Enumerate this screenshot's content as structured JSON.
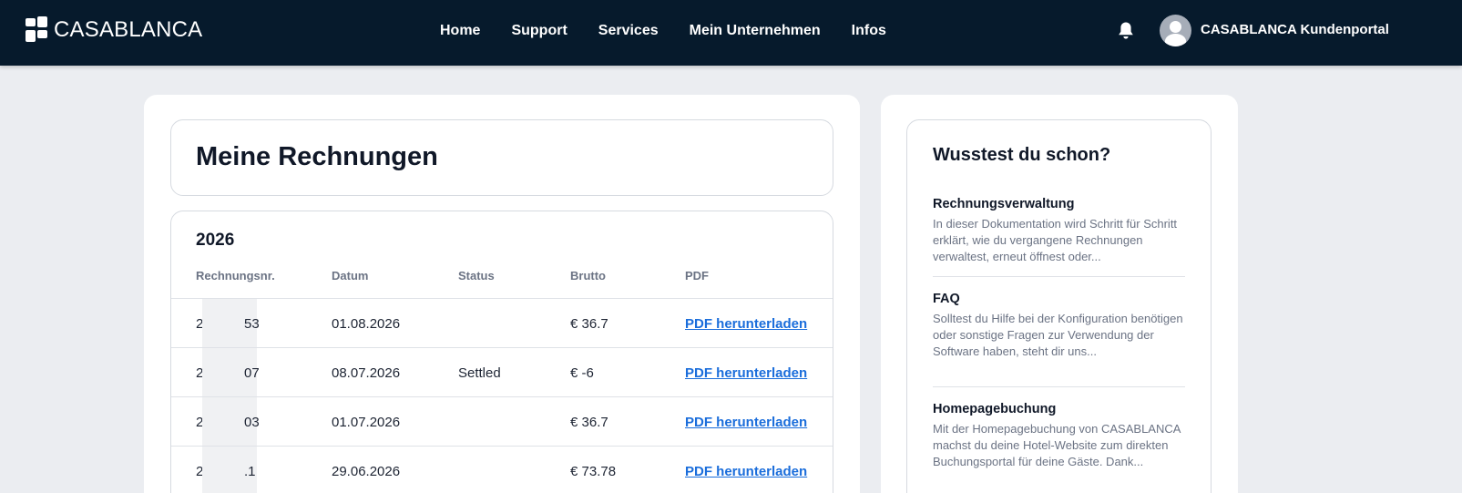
{
  "header": {
    "logo_text": "CASABLANCA",
    "nav": [
      "Home",
      "Support",
      "Services",
      "Mein Unternehmen",
      "Infos"
    ],
    "notification_icon": "bell-icon",
    "user_name": "CASABLANCA Kundenportal",
    "background_color": "#061a2c"
  },
  "main": {
    "title": "Meine Rechnungen",
    "year": "2026",
    "columns": [
      "Rechnungsnr.",
      "Datum",
      "Status",
      "Brutto",
      "PDF"
    ],
    "rows": [
      {
        "nr_start": "2",
        "nr_end": "53",
        "datum": "01.08.2026",
        "status": "",
        "brutto": "€ 36.7",
        "pdf": "PDF herunterladen"
      },
      {
        "nr_start": "2",
        "nr_end": "07",
        "datum": "08.07.2026",
        "status": "Settled",
        "brutto": "€ -6",
        "pdf": "PDF herunterladen"
      },
      {
        "nr_start": "2",
        "nr_end": "03",
        "datum": "01.07.2026",
        "status": "",
        "brutto": "€ 36.7",
        "pdf": "PDF herunterladen"
      },
      {
        "nr_start": "2",
        "nr_end": ".1",
        "datum": "29.06.2026",
        "status": "",
        "brutto": "€ 73.78",
        "pdf": "PDF herunterladen"
      }
    ],
    "link_color": "#1a6ddb"
  },
  "sidebar": {
    "title": "Wusstest du schon?",
    "tips": [
      {
        "title": "Rechnungsverwaltung",
        "text": "In dieser Dokumentation wird Schritt für Schritt erklärt, wie du vergangene Rechnungen verwaltest, erneut öffnest oder..."
      },
      {
        "title": "FAQ",
        "text": "Solltest du Hilfe bei der Konfiguration benötigen oder sonstige Fragen zur Verwendung der Software haben, steht dir uns..."
      },
      {
        "title": "Homepagebuchung",
        "text": "Mit der Homepagebuchung von CASABLANCA machst du deine Hotel-Website zum direkten Buchungsportal für deine Gäste. Dank..."
      }
    ]
  }
}
